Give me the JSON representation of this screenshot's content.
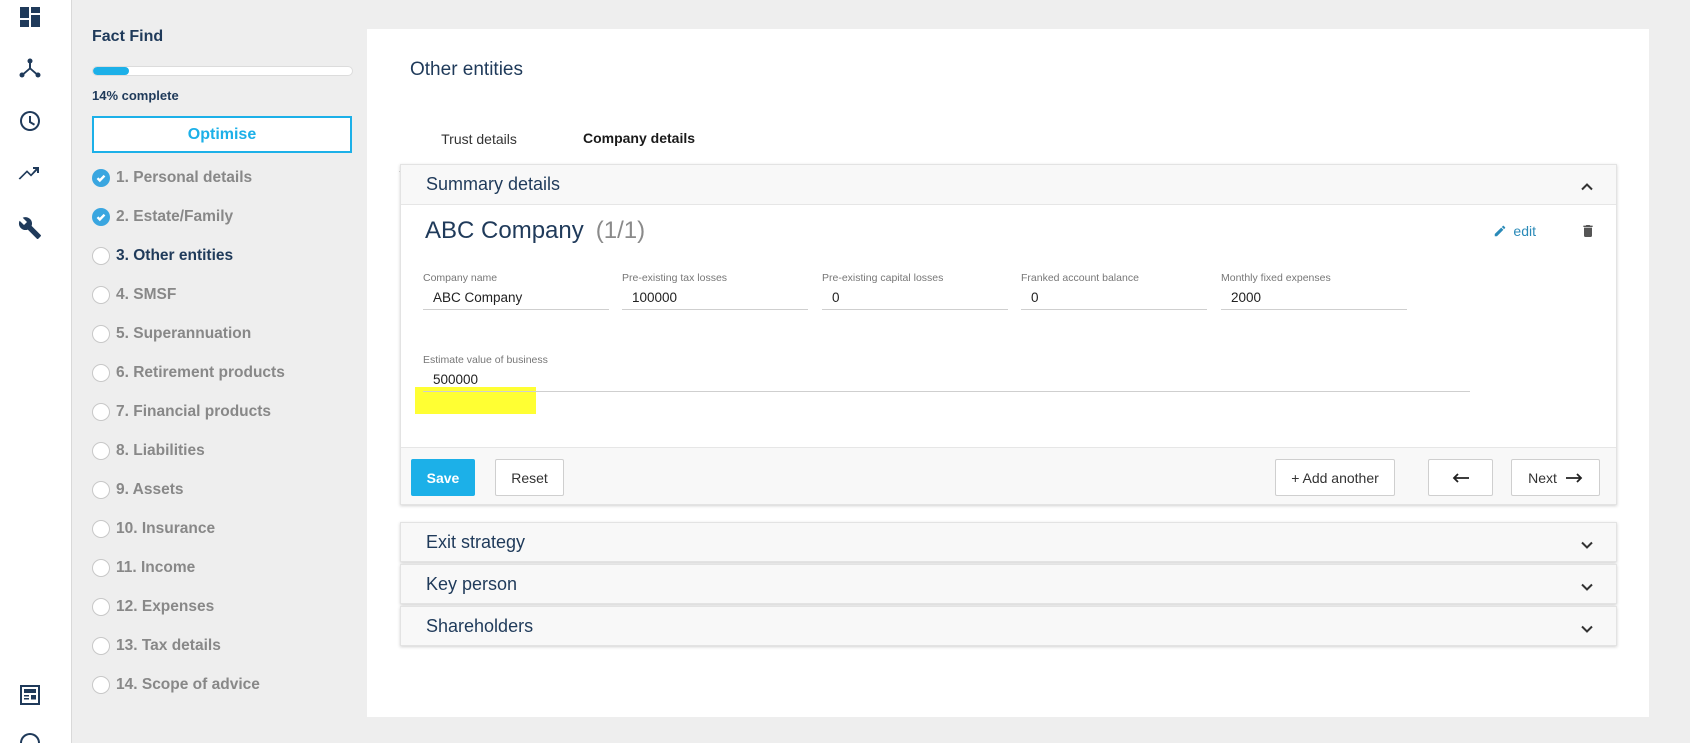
{
  "sidebar": {
    "title": "Fact Find",
    "progress_percent": 14,
    "progress_text": "14% complete",
    "optimise_label": "Optimise",
    "steps": [
      {
        "label": "1. Personal details",
        "state": "done"
      },
      {
        "label": "2. Estate/Family",
        "state": "done"
      },
      {
        "label": "3. Other entities",
        "state": "active"
      },
      {
        "label": "4. SMSF",
        "state": "todo"
      },
      {
        "label": "5. Superannuation",
        "state": "todo"
      },
      {
        "label": "6. Retirement products",
        "state": "todo"
      },
      {
        "label": "7. Financial products",
        "state": "todo"
      },
      {
        "label": "8. Liabilities",
        "state": "todo"
      },
      {
        "label": "9. Assets",
        "state": "todo"
      },
      {
        "label": "10. Insurance",
        "state": "todo"
      },
      {
        "label": "11. Income",
        "state": "todo"
      },
      {
        "label": "12. Expenses",
        "state": "todo"
      },
      {
        "label": "13. Tax details",
        "state": "todo"
      },
      {
        "label": "14. Scope of advice",
        "state": "todo"
      }
    ]
  },
  "main": {
    "title": "Other entities",
    "tabs": [
      {
        "label": "Trust details"
      },
      {
        "label": "Company details"
      }
    ],
    "summary": {
      "heading": "Summary details",
      "company_name": "ABC Company",
      "company_count": "(1/1)",
      "edit_label": "edit",
      "fields": {
        "company_name": {
          "label": "Company name",
          "value": "ABC Company"
        },
        "tax_losses": {
          "label": "Pre-existing tax losses",
          "value": "100000"
        },
        "capital_losses": {
          "label": "Pre-existing capital losses",
          "value": "0"
        },
        "franked_balance": {
          "label": "Franked account balance",
          "value": "0"
        },
        "monthly_expenses": {
          "label": "Monthly fixed expenses",
          "value": "2000"
        },
        "business_value": {
          "label": "Estimate value of business",
          "value": "500000"
        }
      },
      "buttons": {
        "save": "Save",
        "reset": "Reset",
        "add_another": "+ Add another",
        "next": "Next"
      }
    },
    "sections": [
      {
        "heading": "Exit strategy"
      },
      {
        "heading": "Key person"
      },
      {
        "heading": "Shareholders"
      }
    ]
  },
  "colors": {
    "accent": "#1cb0e8",
    "primary_text": "#1f3a5a",
    "highlight": "#ffff33"
  }
}
